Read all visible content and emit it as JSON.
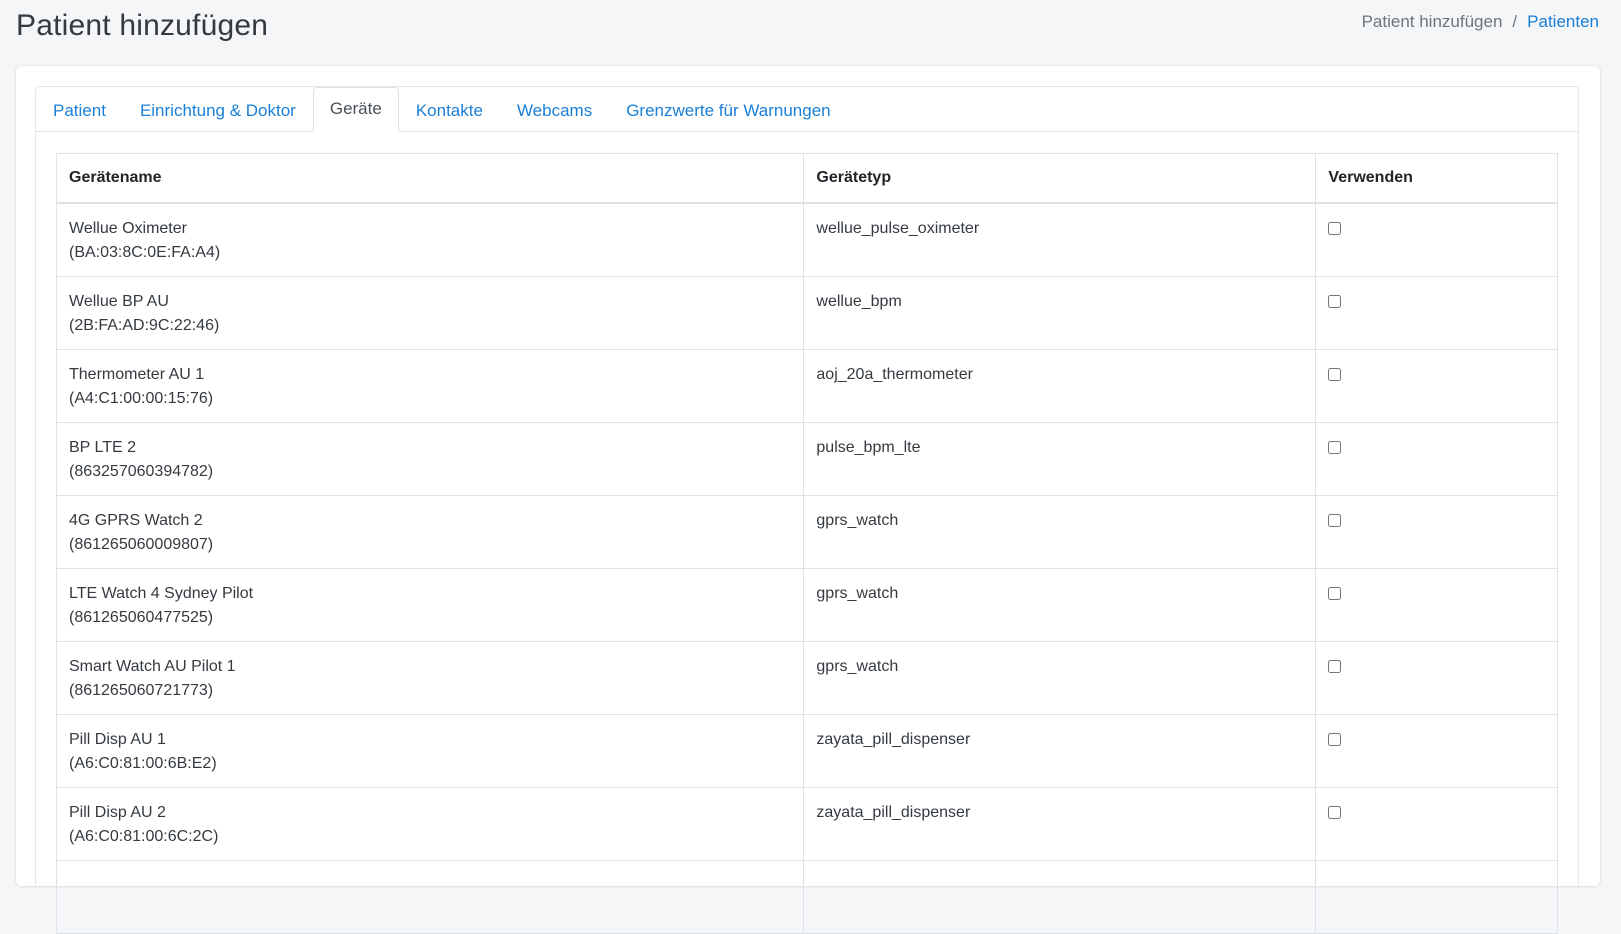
{
  "page": {
    "title": "Patient hinzufügen",
    "breadcrumb": {
      "current": "Patient hinzufügen",
      "separator": "/",
      "link": "Patienten"
    }
  },
  "tabs": [
    {
      "label": "Patient",
      "active": false
    },
    {
      "label": "Einrichtung & Doktor",
      "active": false
    },
    {
      "label": "Geräte",
      "active": true
    },
    {
      "label": "Kontakte",
      "active": false
    },
    {
      "label": "Webcams",
      "active": false
    },
    {
      "label": "Grenzwerte für Warnungen",
      "active": false
    }
  ],
  "table": {
    "headers": {
      "name": "Gerätename",
      "type": "Gerätetyp",
      "use": "Verwenden"
    },
    "rows": [
      {
        "name": "Wellue Oximeter",
        "id": "(BA:03:8C:0E:FA:A4)",
        "type": "wellue_pulse_oximeter",
        "checked": false
      },
      {
        "name": "Wellue BP AU",
        "id": "(2B:FA:AD:9C:22:46)",
        "type": "wellue_bpm",
        "checked": false
      },
      {
        "name": "Thermometer AU 1",
        "id": "(A4:C1:00:00:15:76)",
        "type": "aoj_20a_thermometer",
        "checked": false
      },
      {
        "name": "BP LTE 2",
        "id": "(863257060394782)",
        "type": "pulse_bpm_lte",
        "checked": false
      },
      {
        "name": "4G GPRS Watch 2",
        "id": "(861265060009807)",
        "type": "gprs_watch",
        "checked": false
      },
      {
        "name": "LTE Watch 4 Sydney Pilot",
        "id": "(861265060477525)",
        "type": "gprs_watch",
        "checked": false
      },
      {
        "name": "Smart Watch AU Pilot 1",
        "id": "(861265060721773)",
        "type": "gprs_watch",
        "checked": false
      },
      {
        "name": "Pill Disp AU 1",
        "id": "(A6:C0:81:00:6B:E2)",
        "type": "zayata_pill_dispenser",
        "checked": false
      },
      {
        "name": "Pill Disp AU 2",
        "id": "(A6:C0:81:00:6C:2C)",
        "type": "zayata_pill_dispenser",
        "checked": false
      }
    ]
  },
  "colors": {
    "link": "#1a7fd6",
    "background": "#f5f6f8",
    "border": "#dee2e6"
  }
}
